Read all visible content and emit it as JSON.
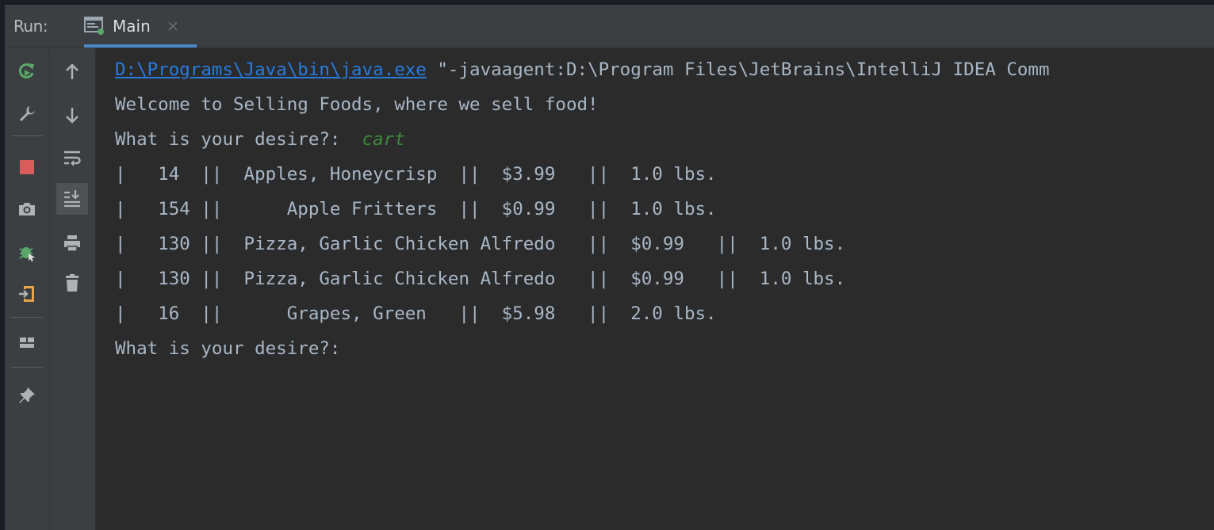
{
  "runbar": {
    "label": "Run:",
    "tab": {
      "label": "Main",
      "icon": "console-window-icon",
      "close_icon": "close-icon"
    }
  },
  "toolbar_left": [
    {
      "name": "rerun-icon",
      "color": "#59a869"
    },
    {
      "name": "wrench-icon",
      "color": "#afb1b3"
    },
    {
      "name": "stop-icon",
      "color": "#db5c5c"
    },
    {
      "name": "camera-icon",
      "color": "#afb1b3"
    },
    {
      "name": "debug-bug-icon",
      "color": "#59a869"
    },
    {
      "name": "exit-icon",
      "color": "#e5a34b"
    },
    {
      "name": "layout-icon",
      "color": "#afb1b3"
    },
    {
      "name": "pin-icon",
      "color": "#afb1b3"
    }
  ],
  "toolbar_right": [
    {
      "name": "arrow-up-icon"
    },
    {
      "name": "arrow-down-icon"
    },
    {
      "name": "soft-wrap-icon"
    },
    {
      "name": "scroll-to-end-icon",
      "active": true
    },
    {
      "name": "print-icon"
    },
    {
      "name": "trash-icon"
    }
  ],
  "console": {
    "command_path": "D:\\Programs\\Java\\bin\\java.exe",
    "command_args": " \"-javaagent:D:\\Program Files\\JetBrains\\IntelliJ IDEA Comm",
    "welcome": "Welcome to Selling Foods, where we sell food!",
    "prompt": "What is your desire?:",
    "user_input": "cart",
    "rows": [
      "|   14  ||  Apples, Honeycrisp  ||  $3.99   ||  1.0 lbs.",
      "|   154 ||      Apple Fritters  ||  $0.99   ||  1.0 lbs.",
      "|   130 ||  Pizza, Garlic Chicken Alfredo   ||  $0.99   ||  1.0 lbs.",
      "|   130 ||  Pizza, Garlic Chicken Alfredo   ||  $0.99   ||  1.0 lbs.",
      "|   16  ||      Grapes, Green   ||  $5.98   ||  2.0 lbs."
    ],
    "final_prompt": "What is your desire?:",
    "colors": {
      "text": "#a9b7c6",
      "link": "#287bde",
      "user_input": "#3b8a3b",
      "background": "#2b2b2b"
    }
  }
}
